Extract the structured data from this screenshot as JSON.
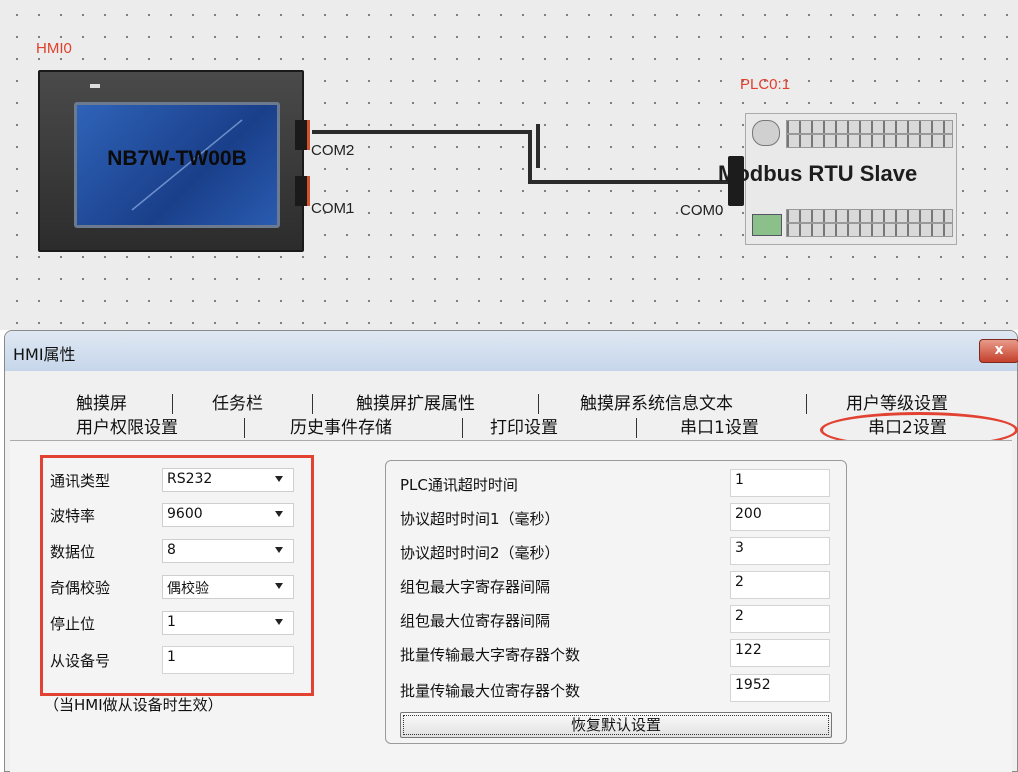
{
  "canvas": {
    "hmi_label": "HMI0",
    "hmi_model": "NB7W-TW00B",
    "hmi_ports": [
      "COM2",
      "COM1"
    ],
    "plc_label": "PLC0:1",
    "plc_name": "Modbus RTU Slave",
    "plc_port": "COM0"
  },
  "dialog": {
    "title": "HMI属性",
    "close_glyph": "x",
    "tabs_row1": [
      "触摸屏",
      "任务栏",
      "触摸屏扩展属性",
      "触摸屏系统信息文本",
      "用户等级设置"
    ],
    "tabs_row2": [
      "用户权限设置",
      "历史事件存储",
      "打印设置",
      "串口1设置",
      "串口2设置"
    ],
    "active_tab": "串口2设置"
  },
  "serial_settings": {
    "comm_type": {
      "label": "通讯类型",
      "value": "RS232"
    },
    "baud_rate": {
      "label": "波特率",
      "value": "9600"
    },
    "data_bits": {
      "label": "数据位",
      "value": "8"
    },
    "parity": {
      "label": "奇偶校验",
      "value": "偶校验"
    },
    "stop_bits": {
      "label": "停止位",
      "value": "1"
    },
    "slave_id": {
      "label": "从设备号",
      "value": "1"
    },
    "note": "（当HMI做从设备时生效）"
  },
  "plc_params": [
    {
      "label": "PLC通讯超时时间",
      "value": "1"
    },
    {
      "label": "协议超时时间1（毫秒）",
      "value": "200"
    },
    {
      "label": "协议超时时间2（毫秒）",
      "value": "3"
    },
    {
      "label": "组包最大字寄存器间隔",
      "value": "2"
    },
    {
      "label": "组包最大位寄存器间隔",
      "value": "2"
    },
    {
      "label": "批量传输最大字寄存器个数",
      "value": "122"
    },
    {
      "label": "批量传输最大位寄存器个数",
      "value": "1952"
    }
  ],
  "reset_button": "恢复默认设置",
  "colors": {
    "highlight": "#e24232",
    "canvas_label": "#e0402c",
    "screen": "#2f63b8"
  }
}
